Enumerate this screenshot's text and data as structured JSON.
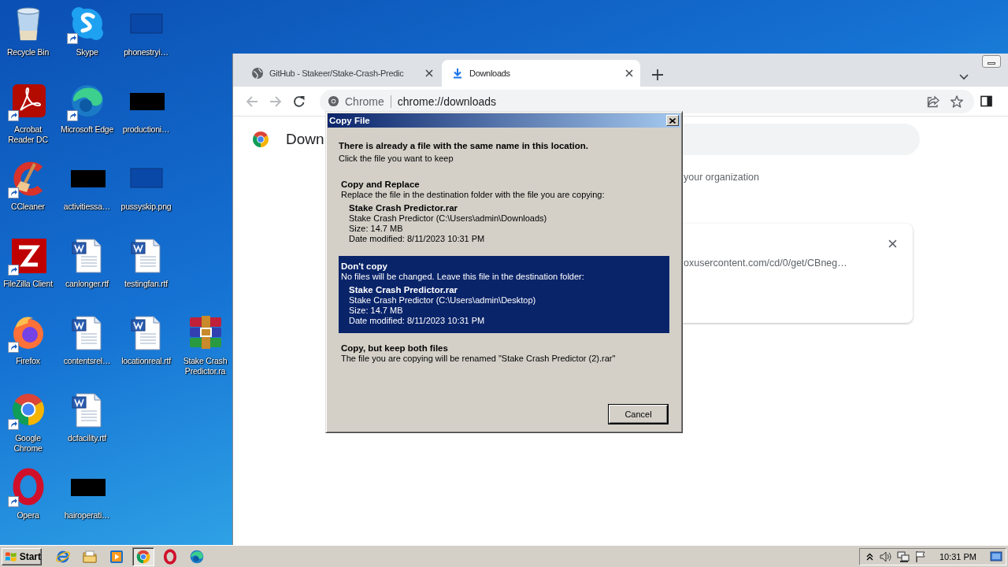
{
  "desktop": {
    "rows": [
      {
        "icons": [
          {
            "label": "Recycle Bin",
            "kind": "recycle",
            "shortcut": false
          },
          {
            "label": "Skype",
            "kind": "skype",
            "shortcut": true
          },
          {
            "label": "phonestryi…",
            "kind": "blank",
            "shortcut": false
          }
        ]
      },
      {
        "icons": [
          {
            "label": "Acrobat Reader DC",
            "kind": "acrobat",
            "shortcut": true
          },
          {
            "label": "Microsoft Edge",
            "kind": "edge",
            "shortcut": true
          },
          {
            "label": "productioni…",
            "kind": "black",
            "shortcut": false
          }
        ]
      },
      {
        "icons": [
          {
            "label": "CCleaner",
            "kind": "ccleaner",
            "shortcut": true
          },
          {
            "label": "activitiessa…",
            "kind": "black",
            "shortcut": false
          },
          {
            "label": "pussyskip.png",
            "kind": "blank",
            "shortcut": false
          }
        ]
      },
      {
        "icons": [
          {
            "label": "FileZilla Client",
            "kind": "filezilla",
            "shortcut": true
          },
          {
            "label": "canlonger.rtf",
            "kind": "word",
            "shortcut": false
          },
          {
            "label": "testingfan.rtf",
            "kind": "word",
            "shortcut": false
          }
        ]
      },
      {
        "icons": [
          {
            "label": "Firefox",
            "kind": "firefox",
            "shortcut": true
          },
          {
            "label": "contentsrel…",
            "kind": "word",
            "shortcut": false
          },
          {
            "label": "locationreal.rtf",
            "kind": "word",
            "shortcut": false
          },
          {
            "label": "Stake Crash Predictor.ra",
            "kind": "winrar",
            "shortcut": false
          }
        ]
      },
      {
        "icons": [
          {
            "label": "Google Chrome",
            "kind": "chrome",
            "shortcut": true
          },
          {
            "label": "dcfacility.rtf",
            "kind": "word",
            "shortcut": false
          }
        ]
      },
      {
        "icons": [
          {
            "label": "Opera",
            "kind": "opera",
            "shortcut": true
          },
          {
            "label": "hairoperati…",
            "kind": "black",
            "shortcut": false
          }
        ]
      }
    ]
  },
  "browser": {
    "tabs": [
      {
        "title": "GitHub - Stakeer/Stake-Crash-Predic",
        "kind": "globe",
        "selected": false
      },
      {
        "title": "Downloads",
        "kind": "download",
        "selected": true
      }
    ],
    "omnibox": {
      "site_label": "Chrome",
      "url": "chrome://downloads"
    },
    "page": {
      "title": "Down",
      "notice": "your organization",
      "download_url": "oxusercontent.com/cd/0/get/CBneg…"
    }
  },
  "dialog": {
    "title": "Copy File",
    "heading": "There is already a file with the same name in this location.",
    "instruction": "Click the file you want to keep",
    "options": [
      {
        "title": "Copy and Replace",
        "description": "Replace the file in the destination folder with the file you are copying:",
        "selected": false,
        "file": {
          "name": "Stake Crash Predictor.rar",
          "location": "Stake Crash Predictor (C:\\Users\\admin\\Downloads)",
          "size": "Size: 14.7 MB",
          "modified": "Date modified: 8/11/2023 10:31 PM"
        }
      },
      {
        "title": "Don't copy",
        "description": "No files will be changed. Leave this file in the destination folder:",
        "selected": true,
        "file": {
          "name": "Stake Crash Predictor.rar",
          "location": "Stake Crash Predictor (C:\\Users\\admin\\Desktop)",
          "size": "Size: 14.7 MB",
          "modified": "Date modified: 8/11/2023 10:31 PM"
        }
      },
      {
        "title": "Copy, but keep both files",
        "description": "The file you are copying will be renamed \"Stake Crash Predictor (2).rar\"",
        "selected": false
      }
    ],
    "cancel_button": "Cancel"
  },
  "taskbar": {
    "start_label": "Start",
    "apps": [
      {
        "kind": "ie",
        "active": false
      },
      {
        "kind": "explorer",
        "active": false
      },
      {
        "kind": "media",
        "active": false
      },
      {
        "kind": "chrome",
        "active": true
      },
      {
        "kind": "opera",
        "active": false
      },
      {
        "kind": "edge",
        "active": false
      }
    ],
    "clock": "10:31 PM"
  }
}
